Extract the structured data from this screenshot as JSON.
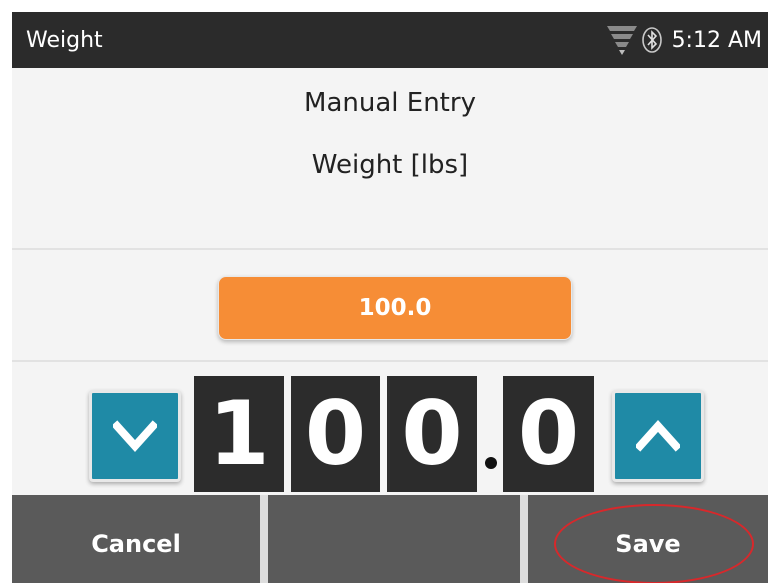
{
  "status_bar": {
    "title": "Weight",
    "time": "5:12 AM",
    "icons": [
      "wifi-icon",
      "bluetooth-icon"
    ]
  },
  "header": {
    "title": "Manual Entry",
    "subtitle": "Weight [lbs]"
  },
  "value_display": {
    "value": "100.0",
    "color": "#f68d36"
  },
  "stepper": {
    "digits": [
      "1",
      "0",
      "0",
      "0"
    ],
    "decimal_separator": ".",
    "down_icon": "chevron-down-icon",
    "up_icon": "chevron-up-icon",
    "button_color": "#1f8aa6"
  },
  "bottom_bar": {
    "cancel_label": "Cancel",
    "middle_label": "",
    "save_label": "Save"
  },
  "annotation": {
    "save_highlight_color": "#d8282b"
  }
}
